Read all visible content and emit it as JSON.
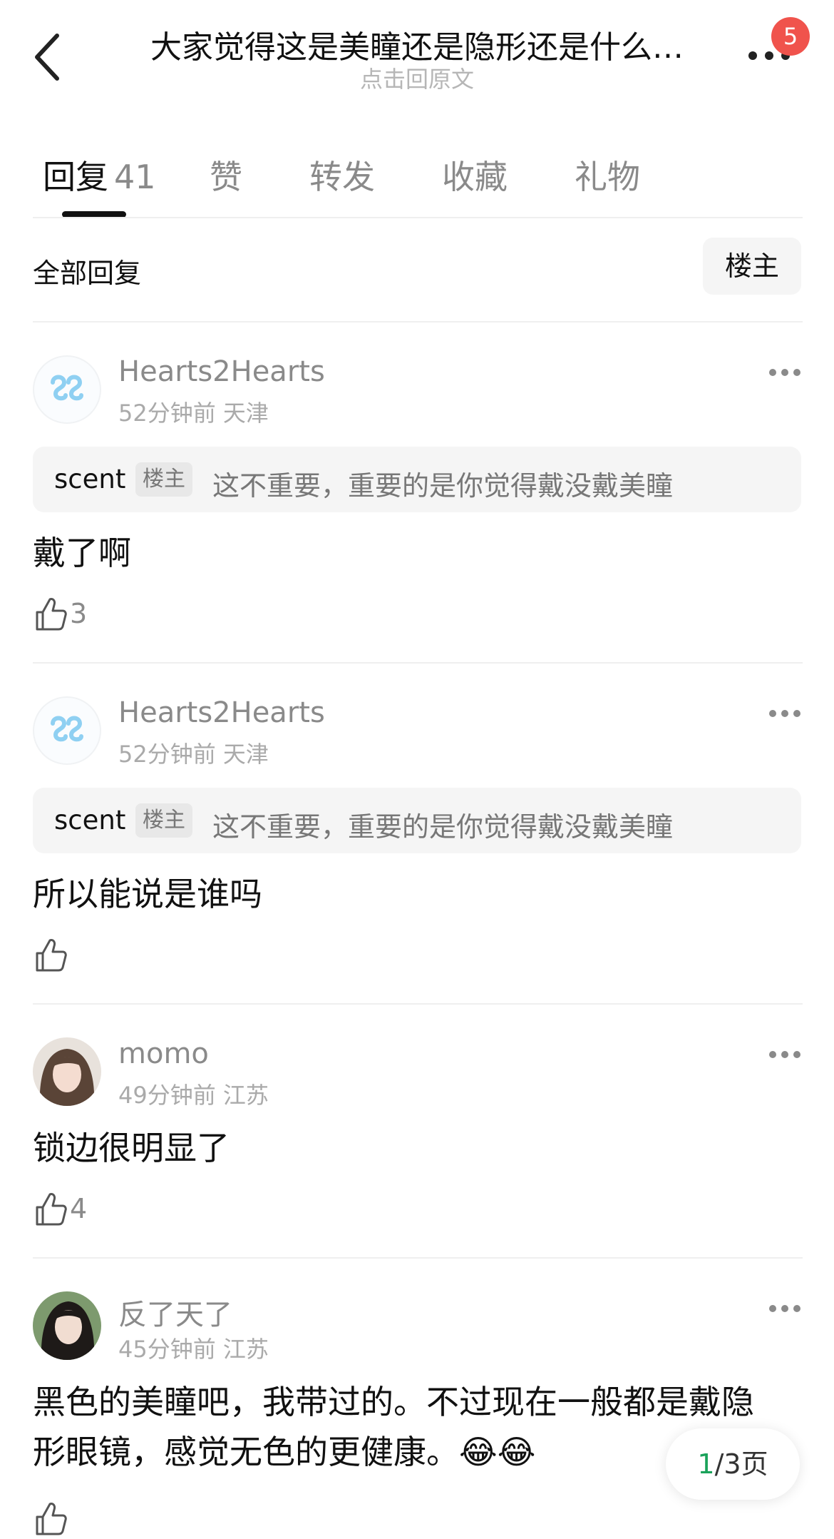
{
  "header": {
    "title": "大家觉得这是美瞳还是隐形还是什么…",
    "subtitle": "点击回原文",
    "badge": "5"
  },
  "tabs": [
    {
      "label": "回复",
      "count": "41"
    },
    {
      "label": "赞"
    },
    {
      "label": "转发"
    },
    {
      "label": "收藏"
    },
    {
      "label": "礼物"
    }
  ],
  "filter": {
    "label": "全部回复",
    "owner_button": "楼主"
  },
  "comments": [
    {
      "user": "Hearts2Hearts",
      "meta": "52分钟前 天津",
      "quote": {
        "name": "scent",
        "tag": "楼主",
        "text": "这不重要，重要的是你觉得戴没戴美瞳"
      },
      "text": "戴了啊",
      "likes": "3"
    },
    {
      "user": "Hearts2Hearts",
      "meta": "52分钟前 天津",
      "quote": {
        "name": "scent",
        "tag": "楼主",
        "text": "这不重要，重要的是你觉得戴没戴美瞳"
      },
      "text": "所以能说是谁吗",
      "likes": ""
    },
    {
      "user": "momo",
      "meta": "49分钟前 江苏",
      "text": "锁边很明显了",
      "likes": "4"
    },
    {
      "user": "反了天了",
      "meta": "45分钟前 江苏",
      "text_line1": "黑色的美瞳吧，我带过的。不过现在一般都是戴隐",
      "text_line2": "形眼镜，感觉无色的更健康。😂😂",
      "likes": ""
    }
  ],
  "pager": {
    "current": "1",
    "total": "/3页"
  }
}
